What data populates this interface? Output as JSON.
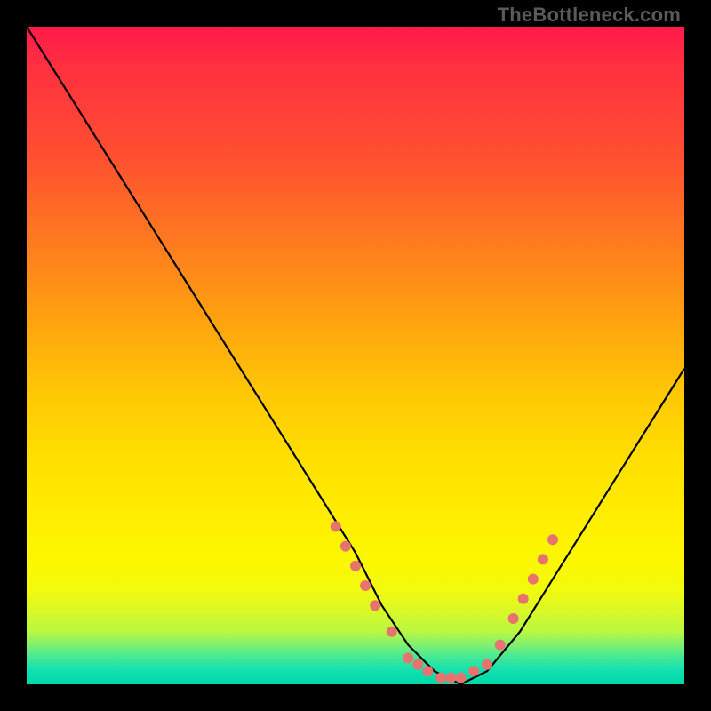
{
  "attribution": "TheBottleneck.com",
  "chart_data": {
    "type": "line",
    "title": "",
    "xlabel": "",
    "ylabel": "",
    "xlim": [
      0,
      100
    ],
    "ylim": [
      0,
      100
    ],
    "grid": false,
    "legend": false,
    "series": [
      {
        "name": "bottleneck-curve",
        "x": [
          0,
          5,
          10,
          15,
          20,
          25,
          30,
          35,
          40,
          45,
          50,
          54,
          58,
          62,
          66,
          70,
          75,
          80,
          85,
          90,
          95,
          100
        ],
        "y": [
          100,
          92,
          84,
          76,
          68,
          60,
          52,
          44,
          36,
          28,
          20,
          12,
          6,
          2,
          0,
          2,
          8,
          16,
          24,
          32,
          40,
          48
        ],
        "color": "#000000"
      }
    ],
    "markers": {
      "name": "highlight-dots",
      "color": "#e8726e",
      "radius_px": 6,
      "points": [
        {
          "x": 47,
          "y": 24
        },
        {
          "x": 48.5,
          "y": 21
        },
        {
          "x": 50,
          "y": 18
        },
        {
          "x": 51.5,
          "y": 15
        },
        {
          "x": 53,
          "y": 12
        },
        {
          "x": 55.5,
          "y": 8
        },
        {
          "x": 58,
          "y": 4
        },
        {
          "x": 59.5,
          "y": 3
        },
        {
          "x": 61,
          "y": 2
        },
        {
          "x": 63,
          "y": 1
        },
        {
          "x": 64.5,
          "y": 1
        },
        {
          "x": 66,
          "y": 1
        },
        {
          "x": 68,
          "y": 2
        },
        {
          "x": 70,
          "y": 3
        },
        {
          "x": 72,
          "y": 6
        },
        {
          "x": 74,
          "y": 10
        },
        {
          "x": 75.5,
          "y": 13
        },
        {
          "x": 77,
          "y": 16
        },
        {
          "x": 78.5,
          "y": 19
        },
        {
          "x": 80,
          "y": 22
        }
      ]
    }
  }
}
